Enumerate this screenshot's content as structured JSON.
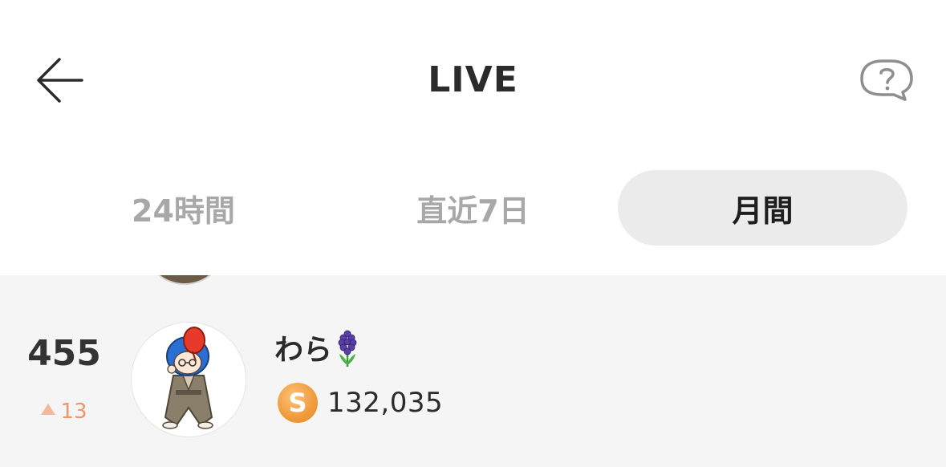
{
  "header": {
    "title": "LIVE",
    "back_icon": "arrow-left-icon",
    "help_icon": "question-bubble-icon"
  },
  "tabs": [
    {
      "label": "24時間",
      "selected": false
    },
    {
      "label": "直近7日",
      "selected": false
    },
    {
      "label": "月間",
      "selected": true
    }
  ],
  "ranking": {
    "rows": [
      {
        "rank": "455",
        "change": "13",
        "change_direction": "up",
        "name": "わら",
        "name_emoji": "hyacinth-icon",
        "points_icon": "S",
        "points": "132,035"
      }
    ]
  },
  "colors": {
    "accent_orange": "#f09a3a",
    "rank_up": "#f0956a",
    "tab_active_bg": "#ebebeb",
    "tab_inactive_text": "#a8a8a8",
    "list_bg": "#f5f5f5"
  }
}
